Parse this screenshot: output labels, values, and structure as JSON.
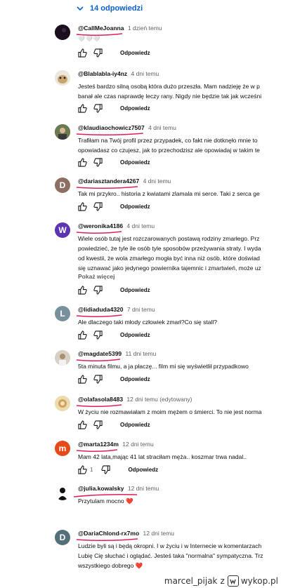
{
  "replies_toggle": "14 odpowiedzi",
  "reply_label": "Odpowiedz",
  "more_label": "Pokaż więcej",
  "comments": [
    {
      "author": "@CallMeJoanna",
      "time": "1 dzień temu",
      "hearts": "🤍🤍🤍",
      "text": []
    },
    {
      "author": "@Blablabla-iy4nz",
      "time": "4 dni temu",
      "text": [
        "Jesteś bardzo silną osobą która dużo przeszła. Mam nadzieję że w p",
        "banał ale czas naprawdę leczy rany. Nigdy nie będzie tak jak wcześni"
      ]
    },
    {
      "author": "@klaudiaochowicz7507",
      "time": "4 dni temu",
      "text": [
        "Trafiłam na Twój profil przez przypadek, co fakt nie dotknęło mnie to",
        "opowiadasz co czujesz, jak to przechodzisz ale opowiadaj w takim te"
      ]
    },
    {
      "author": "@dariasztandera4267",
      "time": "4 dni temu",
      "avatar_letter": "D",
      "text": [
        "Tak mi przykro.. historia z kwiatami zlamala mi serce. Taki z serca ge"
      ]
    },
    {
      "author": "@weronika4186",
      "time": "4 dni temu",
      "avatar_letter": "W",
      "text": [
        "Wiele osób tutaj jest rozczarowanych postawą rodziny zmarłego. Prz",
        "powiedzieć, że tyle ile osób tyle sposobów przeżywania straty. I wyda",
        "od kwestii, że wola zmarłego mogła być inna niż osób, które doświad",
        "się uznawać jako jedynego powiernika tajemnic i zmartwień, może uz"
      ]
    },
    {
      "author": "@lidiaduda4320",
      "time": "7 dni temu",
      "avatar_letter": "L",
      "text": [
        "Ale dlaczego taki młody człowiek zmarł?Co się stall?"
      ]
    },
    {
      "author": "@magdate5399",
      "time": "11 dni temu",
      "text": [
        "5ta minuta filmu, a ja płaczę... film mi się wyświetlił przypadkowo"
      ]
    },
    {
      "author": "@olafasola8483",
      "time": "12 dni temu (edytowany)",
      "text": [
        "W życiu nie rozmawiałam z moim mężem o śmierci. To nie jest norma"
      ]
    },
    {
      "author": "@marta1234m",
      "time": "12 dni temu",
      "avatar_letter": "m",
      "likes": "1",
      "text": [
        "Mam 42 lata,mając 41 lat straciłam męża.. koszmar trwa nadal.."
      ]
    },
    {
      "author": "@julia.kowalsky",
      "time": "12 dni temu",
      "text": [
        "Przytulam mocno ❤️"
      ]
    },
    {
      "author": "@DariaChlond-rx7mo",
      "time": "12 dni temu",
      "avatar_letter": "D",
      "text": [
        "Ludzie byli są i będą okropni. I w życiu i w Internecie w komentarzach",
        "Lubię Cię słuchać i oglądać. Jesteś taka \"normalna\" sympatyczna. Trz",
        "wszystkiego dobrego ❤️"
      ]
    }
  ],
  "footer": {
    "user": "marcel_pijak",
    "z": "z",
    "site": "wykop.pl"
  },
  "colors": {
    "accent": "#065fd4",
    "underline": "#e01e5a",
    "avatar_d": "#8d6e63",
    "avatar_w": "#5e35b1",
    "avatar_l": "#78909c",
    "avatar_m": "#e64a19",
    "avatar_d2": "#546e7a"
  }
}
